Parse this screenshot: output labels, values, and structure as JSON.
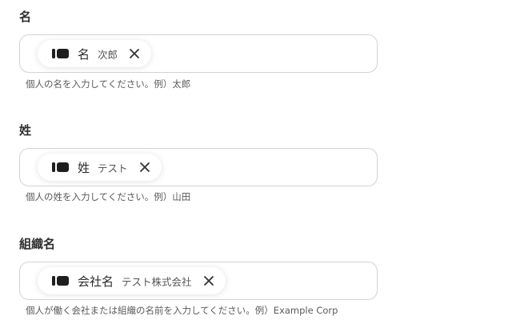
{
  "fields": [
    {
      "label": "名",
      "chip": {
        "icon": "record-field-icon",
        "name": "名",
        "value": "次郎"
      },
      "hint": "個人の名を入力してください。例）太郎"
    },
    {
      "label": "姓",
      "chip": {
        "icon": "record-field-icon",
        "name": "姓",
        "value": "テスト"
      },
      "hint": "個人の姓を入力してください。例）山田"
    },
    {
      "label": "組織名",
      "chip": {
        "icon": "record-field-icon",
        "name": "会社名",
        "value": "テスト株式会社"
      },
      "hint": "個人が働く会社または組織の名前を入力してください。例）Example Corp"
    }
  ],
  "colors": {
    "border": "#d3d3d8",
    "icon": "#1e1e1e",
    "text": "#2b2b2b",
    "hint": "#5a5a5a"
  }
}
